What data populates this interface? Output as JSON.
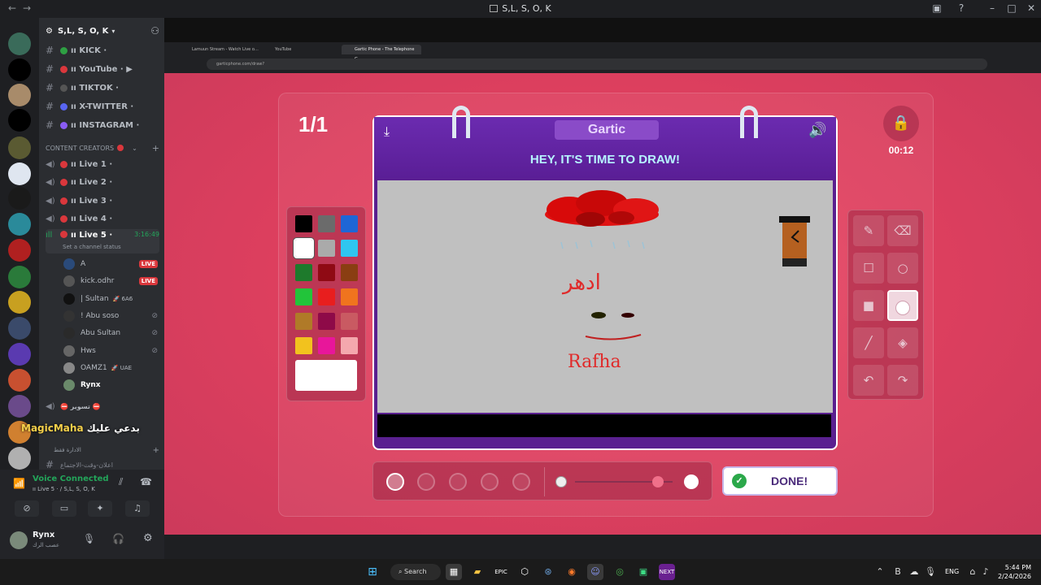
{
  "window": {
    "title": "S,L, S, O, K"
  },
  "server": {
    "name": "S,L, S, O, K"
  },
  "channels": [
    {
      "name": "ıı KICK ·",
      "dot": "#2ea043"
    },
    {
      "name": "ıı YouTube · ▶",
      "dot": "#da373c"
    },
    {
      "name": "ıı TIKTOK ·",
      "dot": "#555"
    },
    {
      "name": "ıı X-TWITTER ·",
      "dot": "#5865f2"
    },
    {
      "name": "ıı INSTAGRAM ·",
      "dot": "#8a5cf5"
    }
  ],
  "category": {
    "name": "CONTENT CREATORS"
  },
  "voice_channels": [
    {
      "name": "ıı Live 1 ·"
    },
    {
      "name": "ıı Live 2 ·"
    },
    {
      "name": "ıı Live 3 ·"
    },
    {
      "name": "ıı Live 4 ·"
    }
  ],
  "active_voice": {
    "name": "ıı Live 5 ·",
    "timer": "3:16:49",
    "status": "Set a channel status"
  },
  "members": [
    {
      "name": "A",
      "live": "LIVE"
    },
    {
      "name": "kick.odhr",
      "live": "LIVE"
    },
    {
      "name": "| Sultan",
      "tag": "🚀 6A6"
    },
    {
      "name": "! Abu soso"
    },
    {
      "name": "Abu Sultan"
    },
    {
      "name": "Hws"
    },
    {
      "name": "OAMZ1",
      "tag": "🚀 UAE"
    },
    {
      "name": "Rynx"
    }
  ],
  "bottom_channels": {
    "ch1": "⛔ تسوير ⛔",
    "cat2": "الادارة فقط",
    "ch2": "اعلان-وقت-الاجتماع"
  },
  "overlay": {
    "name": "MagicMaha",
    "text": "بدعي عليك"
  },
  "voice": {
    "status": "Voice Connected",
    "sub": "ıı Live 5 · / S,L, S, O, K"
  },
  "user": {
    "name": "Rynx",
    "status": "عصب الرك"
  },
  "browser": {
    "tabs": [
      "Lamuun Stream - Watch Live o…",
      "YouTube",
      "Gartic Phone - The Telephone G…"
    ],
    "url": "garticphone.com/draw?"
  },
  "game": {
    "round": "1/1",
    "logo": "Gartic",
    "headline": "HEY, IT'S TIME TO DRAW!",
    "timer": "00:12",
    "done_label": "DONE!",
    "drawing_texts": [
      "ادهر",
      "Rafha"
    ],
    "palette": [
      "#000000",
      "#6b6b6b",
      "#1e66d6",
      "#ffffff",
      "#aaaaaa",
      "#2fc6f0",
      "#1e7a2c",
      "#8f0a14",
      "#8a3e12",
      "#22c43a",
      "#e81e1e",
      "#f0741e",
      "#b07a28",
      "#8e0a48",
      "#c95a62",
      "#f2c21e",
      "#e8169a",
      "#f4a8ae"
    ],
    "selected_color": "#ffffff",
    "slider_value": 0.85
  },
  "taskbar": {
    "search": "Search",
    "time": "5:44 PM",
    "date": "2/24/2026",
    "lang": "ENG"
  }
}
